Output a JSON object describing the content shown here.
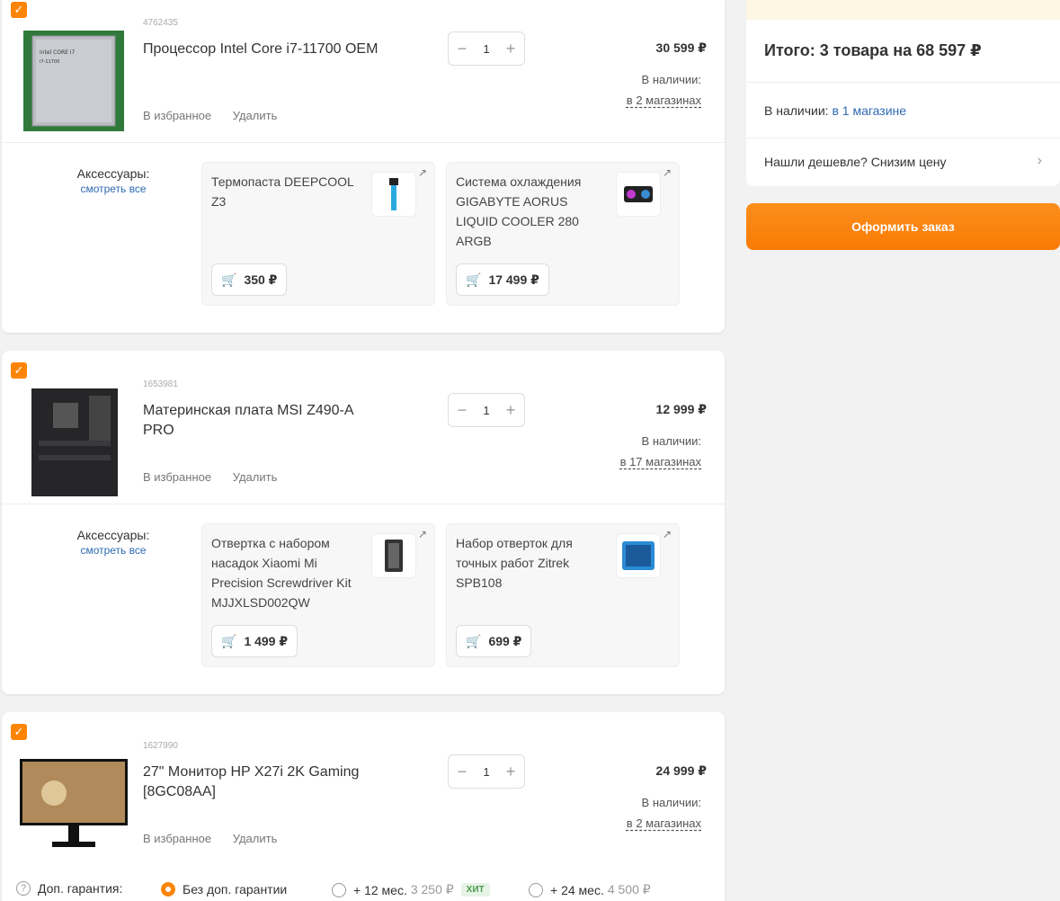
{
  "items": [
    {
      "code": "4762435",
      "title": "Процессор Intel Core i7-11700 OEM",
      "qty": "1",
      "price": "30 599 ₽",
      "avail_label": "В наличии:",
      "avail_link": "в 2 магазинах",
      "fav": "В избранное",
      "remove": "Удалить",
      "acc_label": "Аксессуары:",
      "acc_see": "смотреть все",
      "accessories": [
        {
          "title": "Термопаста DEEPCOOL Z3",
          "price": "350 ₽"
        },
        {
          "title": "Система охлаждения GIGABYTE AORUS LIQUID COOLER 280 ARGB",
          "price": "17 499 ₽"
        }
      ]
    },
    {
      "code": "1653981",
      "title": "Материнская плата MSI Z490-A PRO",
      "qty": "1",
      "price": "12 999 ₽",
      "avail_label": "В наличии:",
      "avail_link": "в 17 магазинах",
      "fav": "В избранное",
      "remove": "Удалить",
      "acc_label": "Аксессуары:",
      "acc_see": "смотреть все",
      "accessories": [
        {
          "title": "Отвертка с набором насадок Xiaomi Mi Precision Screwdriver Kit MJJXLSD002QW",
          "price": "1 499 ₽"
        },
        {
          "title": "Набор отверток для точных работ Zitrek SPB108",
          "price": "699 ₽"
        }
      ]
    },
    {
      "code": "1627990",
      "title": "27\" Монитор HP X27i 2K Gaming [8GC08AA]",
      "qty": "1",
      "price": "24 999 ₽",
      "avail_label": "В наличии:",
      "avail_link": "в 2 магазинах",
      "fav": "В избранное",
      "remove": "Удалить"
    }
  ],
  "warranty": {
    "label": "Доп. гарантия:",
    "opt0": "Без доп. гарантии",
    "opt1": "+ 12 мес.",
    "opt1_price": "3 250 ₽",
    "hit": "ХИТ",
    "opt2": "+ 24 мес.",
    "opt2_price": "4 500 ₽"
  },
  "summary": {
    "total": "Итого: 3 товара на 68 597 ₽",
    "avail_prefix": "В наличии:",
    "avail_link": "в 1 магазине",
    "cheaper": "Нашли дешевле? Снизим цену",
    "order": "Оформить заказ"
  },
  "colors": {
    "accent": "#fc8507",
    "link": "#2e6ab4"
  }
}
